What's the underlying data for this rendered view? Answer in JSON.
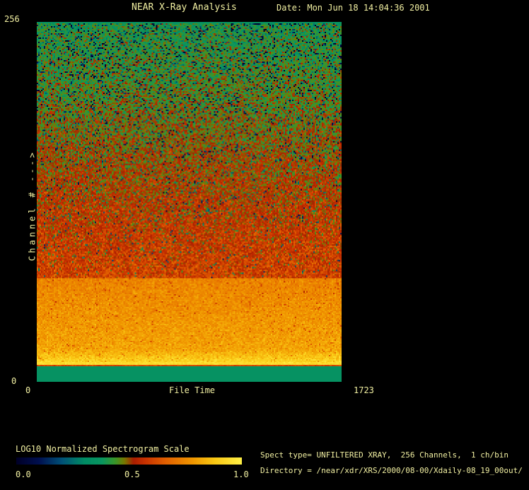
{
  "window": {
    "bg_color": "#000000",
    "text_color": "#f2f0a2"
  },
  "header": {
    "title": "NEAR X-Ray Analysis",
    "date": "Date: Mon Jun 18 14:04:36 2001"
  },
  "plot": {
    "y_axis": {
      "label": "Channel # --->",
      "max": "256",
      "min": "0"
    },
    "x_axis": {
      "label": "File Time",
      "min": "0",
      "max": "1723"
    }
  },
  "colorbar": {
    "title": "LOG10 Normalized Spectrogram Scale",
    "ticks": [
      "0.0",
      "0.5",
      "1.0"
    ]
  },
  "info": {
    "spect_type": "Spect type= UNFILTERED XRAY,  256 Channels,  1 ch/bin",
    "directory": "Directory = /near/xdr/XRS/2000/08-00/Xdaily-08_19_00out/"
  },
  "chart_data": {
    "type": "heatmap",
    "title": "NEAR X-Ray Analysis",
    "xlabel": "File Time",
    "ylabel": "Channel # --->",
    "xlim": [
      0,
      1723
    ],
    "ylim": [
      0,
      256
    ],
    "grid": false,
    "colorbar_title": "LOG10 Normalized Spectrogram Scale",
    "colorbar_range": [
      0.0,
      1.0
    ],
    "colormap_stops": [
      [
        0.0,
        "#000028"
      ],
      [
        0.1,
        "#001050"
      ],
      [
        0.2,
        "#005078"
      ],
      [
        0.3,
        "#008c64"
      ],
      [
        0.38,
        "#0a9660"
      ],
      [
        0.44,
        "#3c9628"
      ],
      [
        0.48,
        "#787800"
      ],
      [
        0.52,
        "#aa1e00"
      ],
      [
        0.57,
        "#c83200"
      ],
      [
        0.66,
        "#e15f00"
      ],
      [
        0.78,
        "#f09600"
      ],
      [
        0.88,
        "#fac814"
      ],
      [
        1.0,
        "#fff046"
      ]
    ],
    "bands": [
      {
        "name": "top-edge-line",
        "channels": [
          255,
          256
        ],
        "row_frac": [
          0.0,
          0.004
        ],
        "value": 0.35,
        "noise": 0
      },
      {
        "name": "green-to-red-gradient-noise",
        "channels": [
          74,
          255
        ],
        "row_frac": [
          0.004,
          0.712
        ],
        "value_start": 0.4,
        "value_end": 0.6,
        "noise": 0.055,
        "dark_speck_p_start": 0.16,
        "dark_speck_p_end": 0.02,
        "dark_speck_drop": 0.3
      },
      {
        "name": "orange-band",
        "channels": [
          14,
          74
        ],
        "row_frac": [
          0.712,
          0.945
        ],
        "value_start": 0.74,
        "value_end": 0.82,
        "noise": 0.03,
        "tail_boost": 0.1,
        "red_speck_p": 0.04,
        "red_speck_drop": 0.12
      },
      {
        "name": "bright-yellow-line",
        "channels": [
          13,
          14
        ],
        "row_frac": [
          0.945,
          0.951
        ],
        "value": 0.94,
        "noise": 0.02
      },
      {
        "name": "separator-line",
        "channels": [
          12,
          13
        ],
        "row_frac": [
          0.951,
          0.955
        ],
        "value": 0.62,
        "noise": 0.02
      },
      {
        "name": "solid-green-footer",
        "channels": [
          0,
          12
        ],
        "row_frac": [
          0.955,
          1.0
        ],
        "value": 0.35,
        "noise": 0
      }
    ]
  }
}
